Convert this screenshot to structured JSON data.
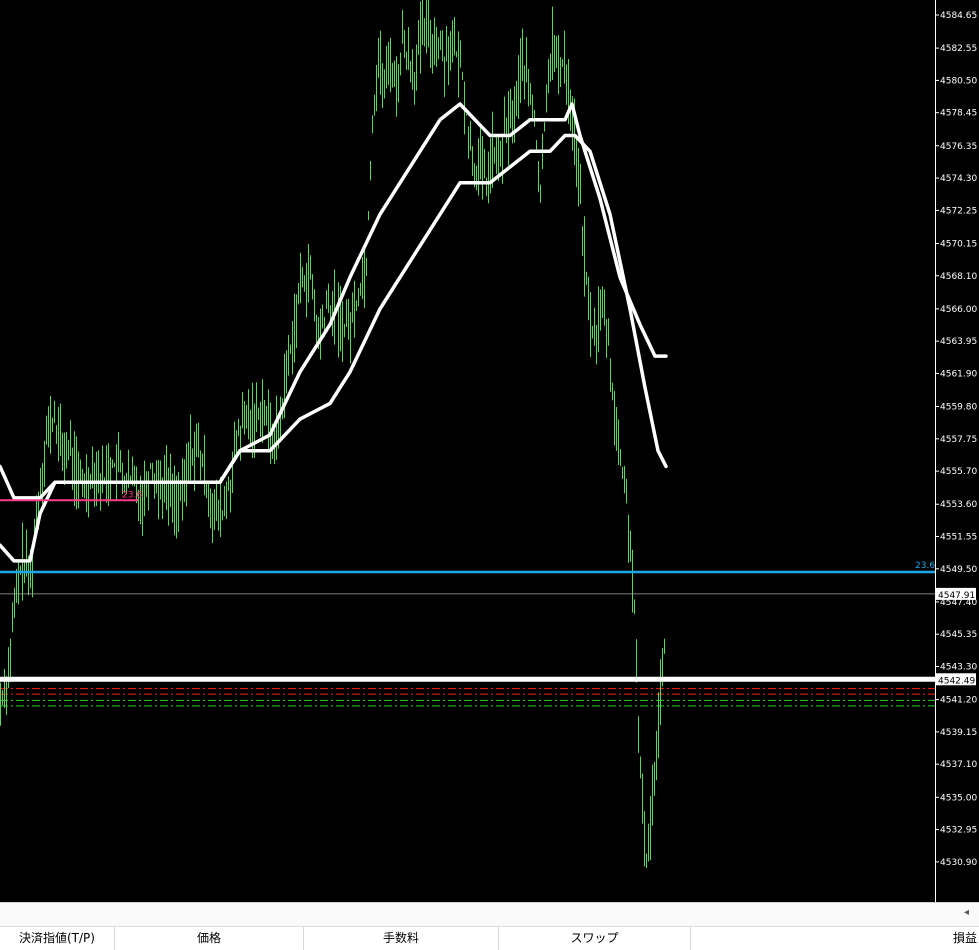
{
  "chart_data": {
    "type": "candlestick",
    "price_axis": {
      "ticks": [
        "4584.65",
        "4582.55",
        "4580.50",
        "4578.45",
        "4576.35",
        "4574.30",
        "4572.25",
        "4570.15",
        "4568.10",
        "4566.00",
        "4563.95",
        "4561.90",
        "4559.80",
        "4557.75",
        "4555.70",
        "4553.60",
        "4551.55",
        "4549.50",
        "4547.40",
        "4545.35",
        "4543.30",
        "4541.20",
        "4539.15",
        "4537.10",
        "4535.00",
        "4532.95",
        "4530.90"
      ]
    },
    "horizontal_lines": [
      {
        "name": "fib-23.6",
        "price": 4549.3,
        "color": "#1ea7e8",
        "label": "23.6"
      },
      {
        "name": "bid-line",
        "price": 4547.91,
        "color": "#aaaaaa",
        "label": "4547.91"
      },
      {
        "name": "position-line",
        "price": 4542.49,
        "color": "#ffffff",
        "label": "4542.49"
      },
      {
        "name": "pink-level",
        "price": 4553.85,
        "color": "#ff3c8c",
        "label": "23.6"
      }
    ],
    "dashed_levels": [
      {
        "price": 4541.9,
        "color": "#ff2020"
      },
      {
        "price": 4541.55,
        "color": "#ff2020"
      },
      {
        "price": 4541.15,
        "color": "#33cc33"
      },
      {
        "price": 4540.8,
        "color": "#33cc33"
      }
    ],
    "close_path": [
      [
        0,
        4541
      ],
      [
        8,
        4543
      ],
      [
        14,
        4547
      ],
      [
        22,
        4550
      ],
      [
        30,
        4549
      ],
      [
        38,
        4554
      ],
      [
        46,
        4558
      ],
      [
        54,
        4559
      ],
      [
        62,
        4557
      ],
      [
        70,
        4557
      ],
      [
        78,
        4555
      ],
      [
        86,
        4555
      ],
      [
        94,
        4556
      ],
      [
        102,
        4555
      ],
      [
        110,
        4556
      ],
      [
        118,
        4556
      ],
      [
        126,
        4555
      ],
      [
        134,
        4555
      ],
      [
        142,
        4554
      ],
      [
        150,
        4556
      ],
      [
        158,
        4555
      ],
      [
        166,
        4555
      ],
      [
        174,
        4554
      ],
      [
        182,
        4554
      ],
      [
        190,
        4557
      ],
      [
        198,
        4557
      ],
      [
        206,
        4555
      ],
      [
        214,
        4553
      ],
      [
        222,
        4553
      ],
      [
        230,
        4555
      ],
      [
        238,
        4558
      ],
      [
        246,
        4559
      ],
      [
        254,
        4559
      ],
      [
        262,
        4560
      ],
      [
        270,
        4558
      ],
      [
        278,
        4558
      ],
      [
        286,
        4562
      ],
      [
        294,
        4565
      ],
      [
        302,
        4568
      ],
      [
        310,
        4568
      ],
      [
        318,
        4564
      ],
      [
        326,
        4566
      ],
      [
        334,
        4566
      ],
      [
        342,
        4565
      ],
      [
        350,
        4565
      ],
      [
        358,
        4567
      ],
      [
        366,
        4569
      ],
      [
        372,
        4578
      ],
      [
        378,
        4582
      ],
      [
        384,
        4580
      ],
      [
        390,
        4582
      ],
      [
        396,
        4580
      ],
      [
        402,
        4583
      ],
      [
        408,
        4582
      ],
      [
        414,
        4581
      ],
      [
        420,
        4583
      ],
      [
        426,
        4584
      ],
      [
        432,
        4583
      ],
      [
        438,
        4583
      ],
      [
        444,
        4582
      ],
      [
        450,
        4583
      ],
      [
        456,
        4582
      ],
      [
        462,
        4581
      ],
      [
        468,
        4577
      ],
      [
        474,
        4575
      ],
      [
        480,
        4575
      ],
      [
        486,
        4574
      ],
      [
        492,
        4576
      ],
      [
        498,
        4575
      ],
      [
        504,
        4577
      ],
      [
        510,
        4578
      ],
      [
        516,
        4579
      ],
      [
        522,
        4582
      ],
      [
        528,
        4580
      ],
      [
        534,
        4578
      ],
      [
        540,
        4573
      ],
      [
        546,
        4580
      ],
      [
        552,
        4583
      ],
      [
        558,
        4581
      ],
      [
        564,
        4582
      ],
      [
        570,
        4579
      ],
      [
        576,
        4576
      ],
      [
        582,
        4571
      ],
      [
        588,
        4566
      ],
      [
        594,
        4564
      ],
      [
        600,
        4566
      ],
      [
        606,
        4565
      ],
      [
        612,
        4561
      ],
      [
        618,
        4557
      ],
      [
        624,
        4555
      ],
      [
        630,
        4551
      ],
      [
        634,
        4547
      ],
      [
        638,
        4538
      ],
      [
        642,
        4535
      ],
      [
        646,
        4531
      ],
      [
        650,
        4533
      ],
      [
        654,
        4537
      ],
      [
        658,
        4540
      ],
      [
        662,
        4544
      ],
      [
        666,
        4546
      ]
    ],
    "ma_fast": [
      [
        0,
        4556
      ],
      [
        14,
        4554
      ],
      [
        30,
        4554
      ],
      [
        40,
        4554
      ],
      [
        55,
        4555
      ],
      [
        80,
        4555
      ],
      [
        110,
        4555
      ],
      [
        140,
        4555
      ],
      [
        170,
        4555
      ],
      [
        200,
        4555
      ],
      [
        220,
        4555
      ],
      [
        240,
        4557
      ],
      [
        270,
        4558
      ],
      [
        300,
        4562
      ],
      [
        330,
        4565
      ],
      [
        350,
        4568
      ],
      [
        365,
        4570
      ],
      [
        380,
        4572
      ],
      [
        400,
        4574
      ],
      [
        420,
        4576
      ],
      [
        440,
        4578
      ],
      [
        460,
        4579
      ],
      [
        475,
        4578
      ],
      [
        490,
        4577
      ],
      [
        510,
        4577
      ],
      [
        530,
        4578
      ],
      [
        550,
        4578
      ],
      [
        565,
        4578
      ],
      [
        572,
        4579
      ],
      [
        580,
        4577
      ],
      [
        600,
        4573
      ],
      [
        620,
        4568
      ],
      [
        640,
        4565
      ],
      [
        655,
        4563
      ],
      [
        666,
        4563
      ]
    ],
    "ma_slow": [
      [
        0,
        4551
      ],
      [
        14,
        4550
      ],
      [
        30,
        4550
      ],
      [
        40,
        4553
      ],
      [
        55,
        4555
      ],
      [
        80,
        4555
      ],
      [
        110,
        4555
      ],
      [
        140,
        4555
      ],
      [
        170,
        4555
      ],
      [
        200,
        4555
      ],
      [
        220,
        4555
      ],
      [
        240,
        4557
      ],
      [
        270,
        4557
      ],
      [
        300,
        4559
      ],
      [
        330,
        4560
      ],
      [
        350,
        4562
      ],
      [
        365,
        4564
      ],
      [
        380,
        4566
      ],
      [
        400,
        4568
      ],
      [
        420,
        4570
      ],
      [
        440,
        4572
      ],
      [
        460,
        4574
      ],
      [
        475,
        4574
      ],
      [
        490,
        4574
      ],
      [
        510,
        4575
      ],
      [
        530,
        4576
      ],
      [
        550,
        4576
      ],
      [
        565,
        4577
      ],
      [
        575,
        4577
      ],
      [
        590,
        4576
      ],
      [
        610,
        4572
      ],
      [
        630,
        4566
      ],
      [
        645,
        4561
      ],
      [
        658,
        4557
      ],
      [
        666,
        4556
      ]
    ]
  },
  "bottom_panel": {
    "columns": [
      "決済指値(T/P)",
      "価格",
      "手数料",
      "スワップ",
      "損益"
    ],
    "scroll_arrow": "◂"
  },
  "colors": {
    "background": "#000000",
    "candle": "#58d858",
    "ma": "#ffffff",
    "axis_text": "#ffffff"
  }
}
